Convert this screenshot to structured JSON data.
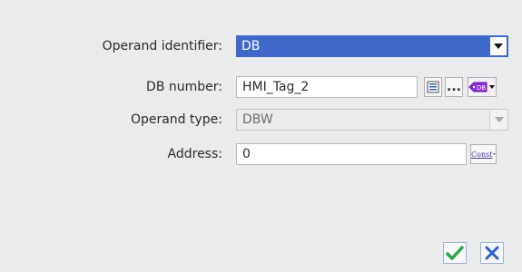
{
  "form": {
    "operand_identifier": {
      "label": "Operand identifier:",
      "value": "DB"
    },
    "db_number": {
      "label": "DB number:",
      "value": "HMI_Tag_2",
      "browse_label": "..."
    },
    "operand_type": {
      "label": "Operand type:",
      "value": "DBW"
    },
    "address": {
      "label": "Address:",
      "value": "0",
      "const_label": "Const"
    }
  },
  "icons": {
    "ok": "checkmark-icon",
    "cancel": "x-icon",
    "list": "list-icon",
    "tag": "tag-db-icon",
    "dropdown": "chevron-down-icon"
  },
  "colors": {
    "selection": "#3f68c8",
    "ok": "#2fa44a",
    "cancel": "#2a5fcf"
  }
}
